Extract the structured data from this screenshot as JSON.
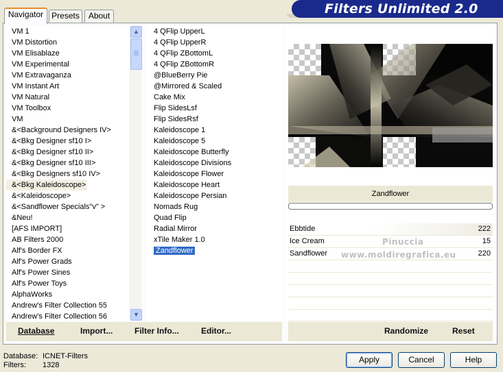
{
  "banner": {
    "title": "Filters Unlimited 2.0"
  },
  "tabs": [
    {
      "label": "Navigator",
      "active": true
    },
    {
      "label": "Presets",
      "active": false
    },
    {
      "label": "About",
      "active": false
    }
  ],
  "categories": {
    "items": [
      "VM 1",
      "VM Distortion",
      "VM Elisablaze",
      "VM Experimental",
      "VM Extravaganza",
      "VM Instant Art",
      "VM Natural",
      "VM Toolbox",
      "VM",
      "&<Background Designers IV>",
      "&<Bkg Designer sf10 I>",
      "&<Bkg Designer sf10 II>",
      "&<Bkg Designer sf10 III>",
      "&<Bkg Designers sf10 IV>",
      "&<Bkg Kaleidoscope>",
      "&<Kaleidoscope>",
      "&<Sandflower Specials\"v\" >",
      "&Neu!",
      "[AFS IMPORT]",
      "AB Filters 2000",
      "Alf's Border FX",
      "Alf's Power Grads",
      "Alf's Power Sines",
      "Alf's Power Toys",
      "AlphaWorks",
      "Andrew's Filter Collection 55",
      "Andrew's Filter Collection 56"
    ],
    "selected": "&<Bkg Kaleidoscope>"
  },
  "filters": {
    "items": [
      "4 QFlip UpperL",
      "4 QFlip UpperR",
      "4 QFlip ZBottomL",
      "4 QFlip ZBottomR",
      "@BlueBerry Pie",
      "@Mirrored & Scaled",
      "Cake Mix",
      "Flip SidesLsf",
      "Flip SidesRsf",
      "Kaleidoscope 1",
      "Kaleidoscope 5",
      "Kaleidoscope Butterfly",
      "Kaleidoscope Divisions",
      "Kaleidoscope Flower",
      "Kaleidoscope Heart",
      "Kaleidoscope Persian",
      "Nomads Rug",
      "Quad Flip",
      "Radial Mirror",
      "xTile Maker 1.0",
      "Zandflower"
    ],
    "selected": "Zandflower"
  },
  "filter_name": "Zandflower",
  "params": [
    {
      "name": "Ebbtide",
      "value": "222"
    },
    {
      "name": "Ice Cream",
      "value": "15"
    },
    {
      "name": "Sandflower",
      "value": "220"
    }
  ],
  "watermark": {
    "line1": "Pinuccia",
    "line2": "www.moldiregrafica.eu"
  },
  "actions": {
    "database": "Database",
    "import": "Import...",
    "filter_info": "Filter Info...",
    "editor": "Editor...",
    "randomize": "Randomize",
    "reset": "Reset"
  },
  "status": {
    "database_label": "Database:",
    "database_value": "ICNET-Filters",
    "filters_label": "Filters:",
    "filters_value": "1328"
  },
  "buttons": {
    "apply": "Apply",
    "cancel": "Cancel",
    "help": "Help"
  }
}
